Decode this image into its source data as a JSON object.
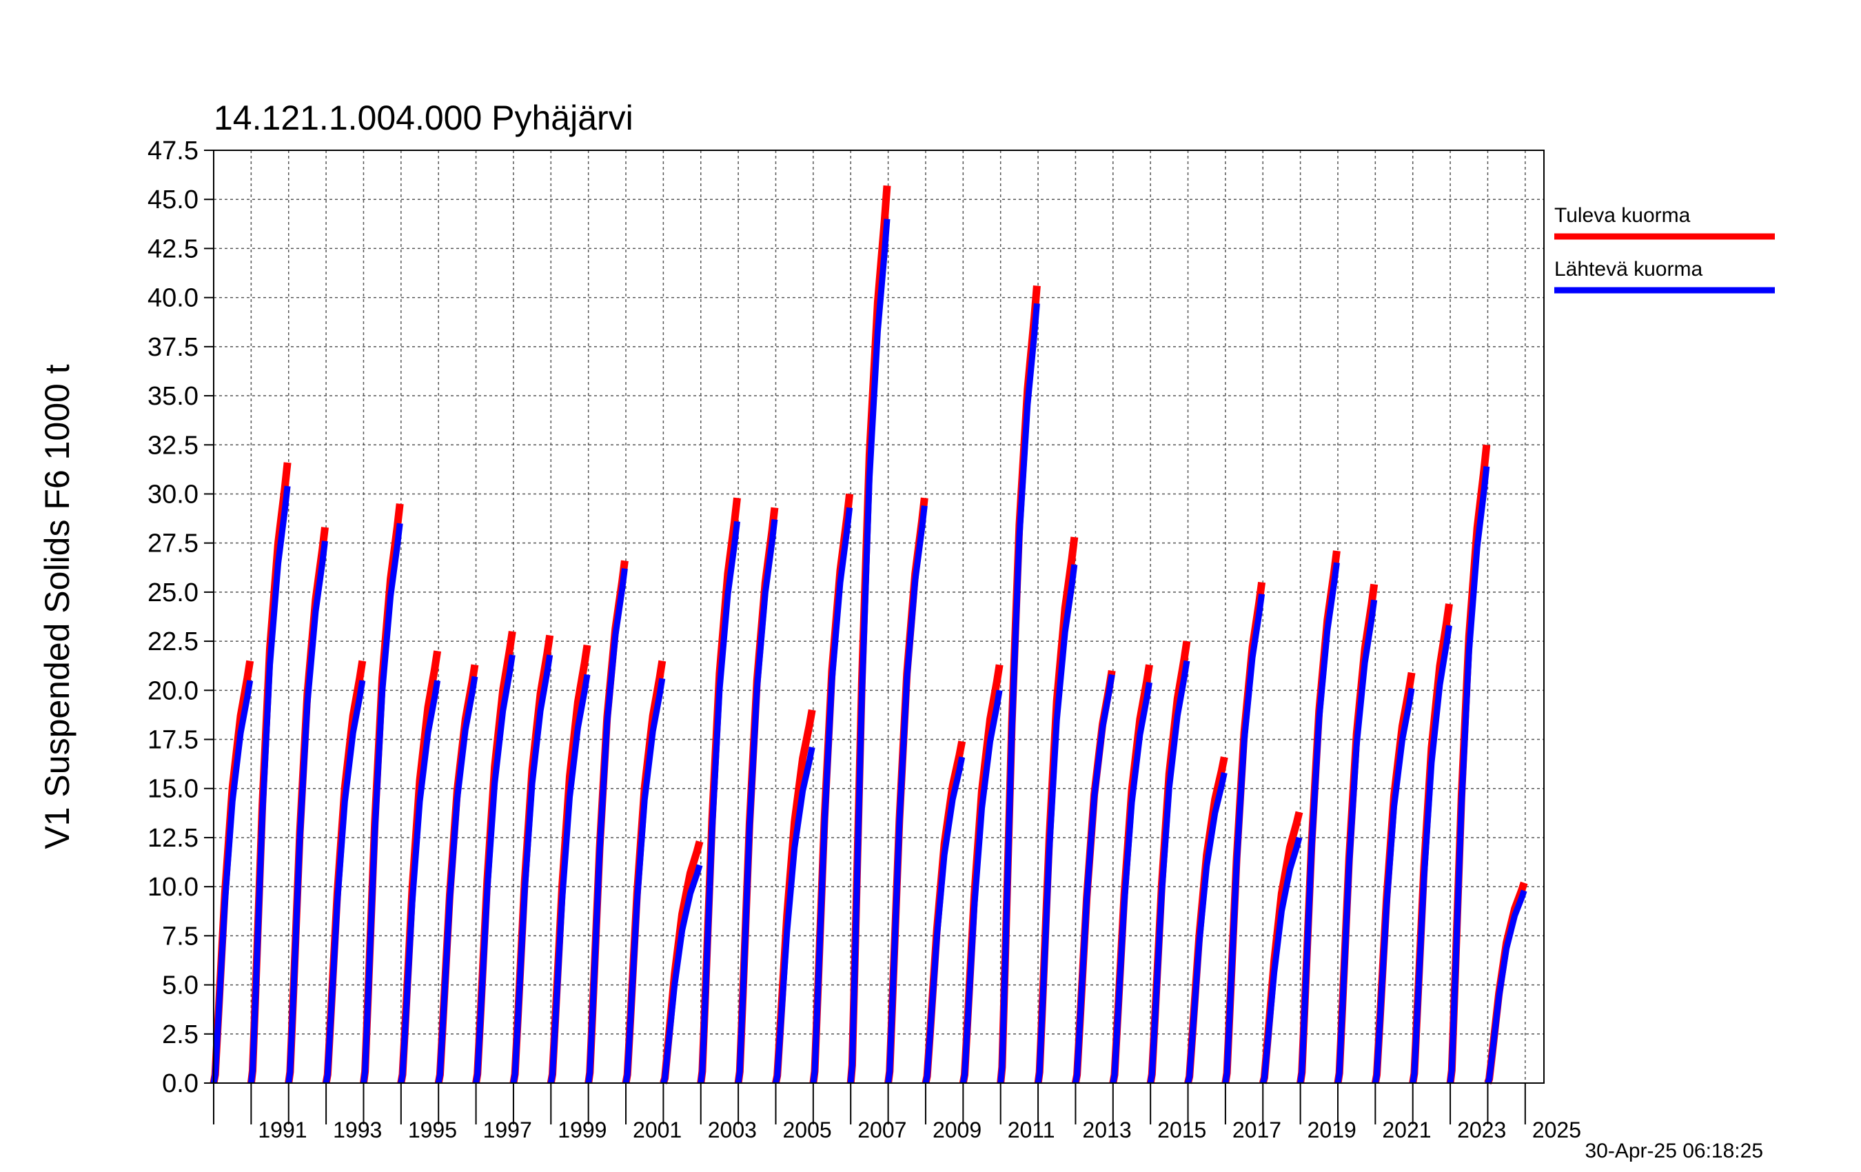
{
  "chart_data": {
    "type": "line",
    "title": "14.121.1.004.000 Pyhäjärvi",
    "ylabel": "V1 Suspended Solids F6 1000 t",
    "xlabel": "",
    "ylim": [
      0,
      47.5
    ],
    "xlim": [
      1990,
      2025.5
    ],
    "y_ticks": [
      0.0,
      2.5,
      5.0,
      7.5,
      10.0,
      12.5,
      15.0,
      17.5,
      20.0,
      22.5,
      25.0,
      27.5,
      30.0,
      32.5,
      35.0,
      37.5,
      40.0,
      42.5,
      45.0,
      47.5
    ],
    "x_ticks": [
      "1991",
      "1993",
      "1995",
      "1997",
      "1999",
      "2001",
      "2003",
      "2005",
      "2007",
      "2009",
      "2011",
      "2013",
      "2015",
      "2017",
      "2019",
      "2021",
      "2023",
      "2025"
    ],
    "grid": true,
    "legend_position": "right",
    "series": [
      {
        "name": "Tuleva kuorma",
        "color": "#ff0000",
        "annual_totals": [
          {
            "year": 1990,
            "total": 21.5
          },
          {
            "year": 1991,
            "total": 31.6
          },
          {
            "year": 1992,
            "total": 28.3
          },
          {
            "year": 1993,
            "total": 21.5
          },
          {
            "year": 1994,
            "total": 29.5
          },
          {
            "year": 1995,
            "total": 22.0
          },
          {
            "year": 1996,
            "total": 21.3
          },
          {
            "year": 1997,
            "total": 23.0
          },
          {
            "year": 1998,
            "total": 22.8
          },
          {
            "year": 1999,
            "total": 22.3
          },
          {
            "year": 2000,
            "total": 26.6
          },
          {
            "year": 2001,
            "total": 21.5
          },
          {
            "year": 2002,
            "total": 12.3
          },
          {
            "year": 2003,
            "total": 29.8
          },
          {
            "year": 2004,
            "total": 29.3
          },
          {
            "year": 2005,
            "total": 19.0
          },
          {
            "year": 2006,
            "total": 30.0
          },
          {
            "year": 2007,
            "total": 45.7
          },
          {
            "year": 2008,
            "total": 29.8
          },
          {
            "year": 2009,
            "total": 17.4
          },
          {
            "year": 2010,
            "total": 21.3
          },
          {
            "year": 2011,
            "total": 40.6
          },
          {
            "year": 2012,
            "total": 27.8
          },
          {
            "year": 2013,
            "total": 21.0
          },
          {
            "year": 2014,
            "total": 21.3
          },
          {
            "year": 2015,
            "total": 22.5
          },
          {
            "year": 2016,
            "total": 16.6
          },
          {
            "year": 2017,
            "total": 25.5
          },
          {
            "year": 2018,
            "total": 13.8
          },
          {
            "year": 2019,
            "total": 27.1
          },
          {
            "year": 2020,
            "total": 25.4
          },
          {
            "year": 2021,
            "total": 20.9
          },
          {
            "year": 2022,
            "total": 24.4
          },
          {
            "year": 2023,
            "total": 32.5
          },
          {
            "year": 2024,
            "total": 10.2
          }
        ]
      },
      {
        "name": "Lähtevä kuorma",
        "color": "#0000ff",
        "annual_totals": [
          {
            "year": 1990,
            "total": 20.5
          },
          {
            "year": 1991,
            "total": 30.4
          },
          {
            "year": 1992,
            "total": 27.6
          },
          {
            "year": 1993,
            "total": 20.5
          },
          {
            "year": 1994,
            "total": 28.5
          },
          {
            "year": 1995,
            "total": 20.5
          },
          {
            "year": 1996,
            "total": 20.7
          },
          {
            "year": 1997,
            "total": 21.8
          },
          {
            "year": 1998,
            "total": 21.8
          },
          {
            "year": 1999,
            "total": 20.8
          },
          {
            "year": 2000,
            "total": 26.2
          },
          {
            "year": 2001,
            "total": 20.6
          },
          {
            "year": 2002,
            "total": 11.1
          },
          {
            "year": 2003,
            "total": 28.6
          },
          {
            "year": 2004,
            "total": 28.7
          },
          {
            "year": 2005,
            "total": 17.1
          },
          {
            "year": 2006,
            "total": 29.3
          },
          {
            "year": 2007,
            "total": 44.0
          },
          {
            "year": 2008,
            "total": 29.4
          },
          {
            "year": 2009,
            "total": 16.6
          },
          {
            "year": 2010,
            "total": 20.0
          },
          {
            "year": 2011,
            "total": 39.7
          },
          {
            "year": 2012,
            "total": 26.4
          },
          {
            "year": 2013,
            "total": 20.8
          },
          {
            "year": 2014,
            "total": 20.4
          },
          {
            "year": 2015,
            "total": 21.5
          },
          {
            "year": 2016,
            "total": 15.8
          },
          {
            "year": 2017,
            "total": 24.9
          },
          {
            "year": 2018,
            "total": 12.5
          },
          {
            "year": 2019,
            "total": 26.5
          },
          {
            "year": 2020,
            "total": 24.6
          },
          {
            "year": 2021,
            "total": 20.1
          },
          {
            "year": 2022,
            "total": 23.3
          },
          {
            "year": 2023,
            "total": 31.4
          },
          {
            "year": 2024,
            "total": 9.8
          }
        ]
      }
    ]
  },
  "legend": {
    "items": [
      {
        "label": "Tuleva kuorma",
        "color": "#ff0000"
      },
      {
        "label": "Lähtevä kuorma",
        "color": "#0000ff"
      }
    ]
  },
  "timestamp": "30-Apr-25 06:18:25"
}
